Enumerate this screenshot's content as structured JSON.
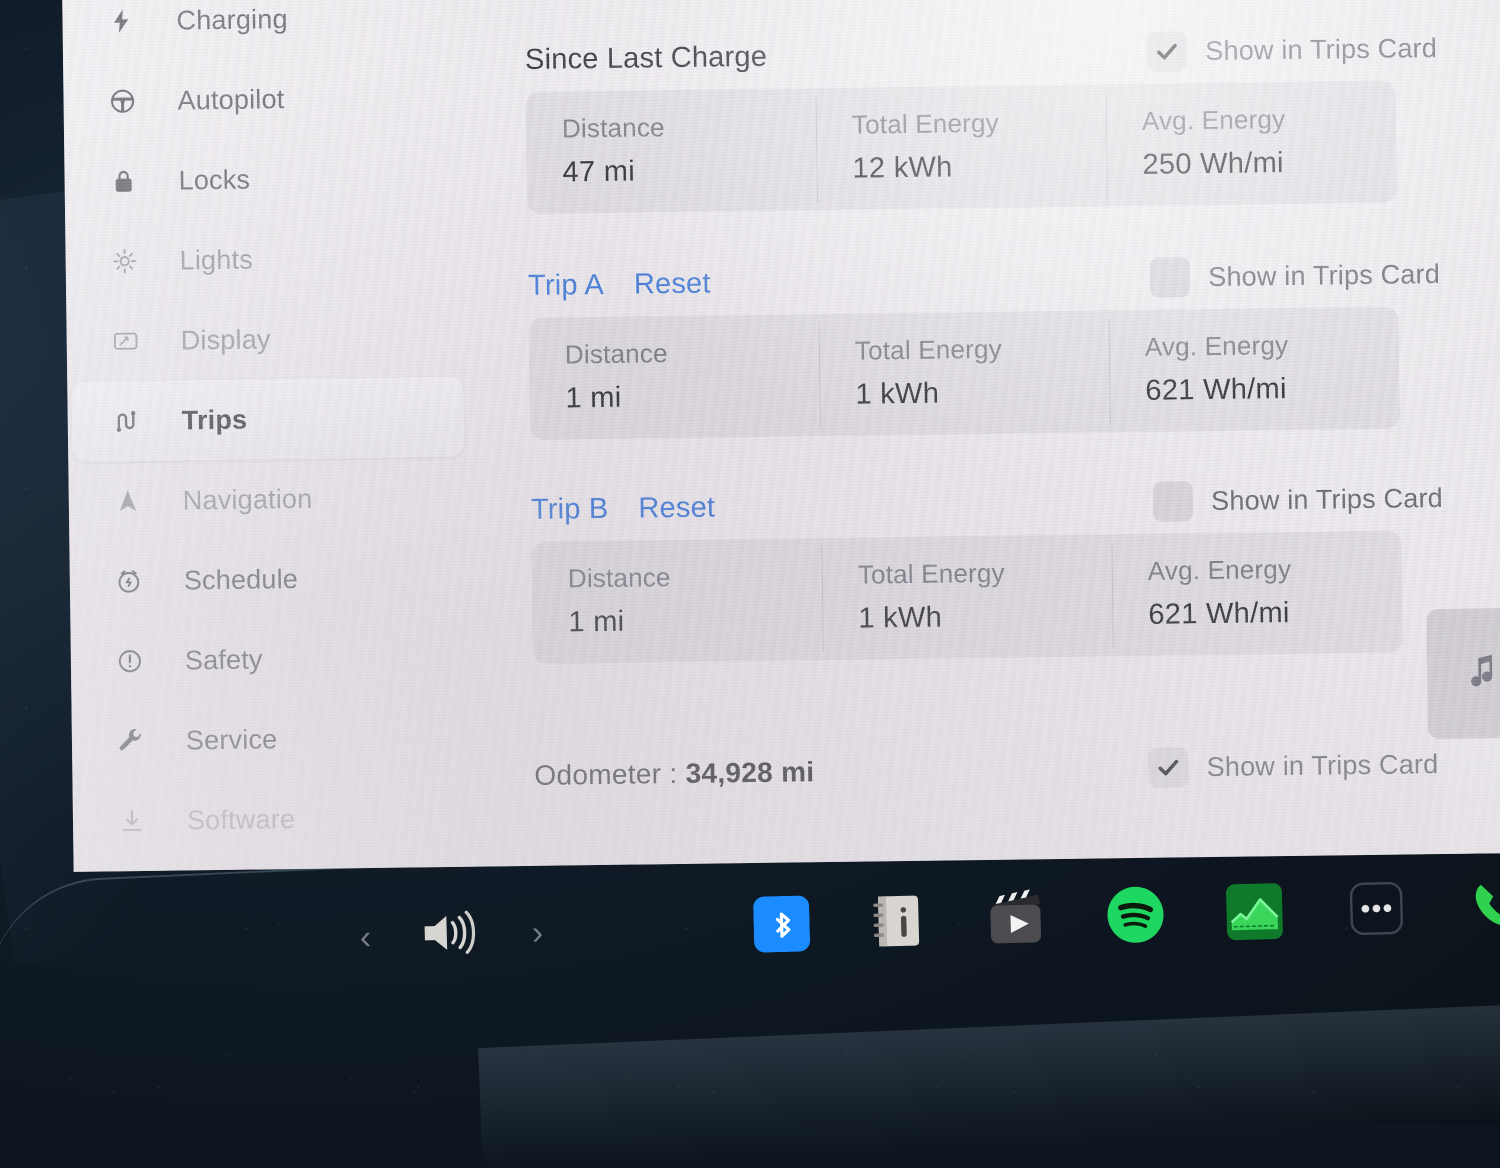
{
  "sidebar": {
    "items": [
      {
        "label": "Charging",
        "icon": "bolt-icon",
        "state": "normal"
      },
      {
        "label": "Autopilot",
        "icon": "steering-wheel-icon",
        "state": "normal"
      },
      {
        "label": "Locks",
        "icon": "lock-icon",
        "state": "normal"
      },
      {
        "label": "Lights",
        "icon": "lights-icon",
        "state": "faded"
      },
      {
        "label": "Display",
        "icon": "display-icon",
        "state": "faded"
      },
      {
        "label": "Trips",
        "icon": "trips-route-icon",
        "state": "active"
      },
      {
        "label": "Navigation",
        "icon": "navigation-arrow-icon",
        "state": "faded"
      },
      {
        "label": "Schedule",
        "icon": "schedule-clock-icon",
        "state": "normal"
      },
      {
        "label": "Safety",
        "icon": "safety-alert-icon",
        "state": "normal"
      },
      {
        "label": "Service",
        "icon": "wrench-icon",
        "state": "normal"
      },
      {
        "label": "Software",
        "icon": "download-icon",
        "state": "ghost"
      }
    ]
  },
  "content": {
    "show_in_trips_card_label": "Show in Trips Card",
    "columns": {
      "distance": "Distance",
      "total_energy": "Total Energy",
      "avg_energy": "Avg. Energy"
    },
    "sections": [
      {
        "id": "since-last-charge",
        "title": "Since Last Charge",
        "is_trip": false,
        "reset_label": "",
        "show_in_trips_card": true,
        "distance": "47 mi",
        "total_energy": "12 kWh",
        "avg_energy": "250 Wh/mi"
      },
      {
        "id": "trip-a",
        "title": "Trip A",
        "is_trip": true,
        "reset_label": "Reset",
        "show_in_trips_card": false,
        "distance": "1 mi",
        "total_energy": "1 kWh",
        "avg_energy": "621 Wh/mi"
      },
      {
        "id": "trip-b",
        "title": "Trip B",
        "is_trip": true,
        "reset_label": "Reset",
        "show_in_trips_card": false,
        "distance": "1 mi",
        "total_energy": "1 kWh",
        "avg_energy": "621 Wh/mi"
      }
    ],
    "odometer": {
      "label": "Odometer",
      "separator": ":",
      "value": "34,928 mi",
      "show_in_trips_card": true
    },
    "media_card": {
      "icon": "music-note-icon"
    }
  },
  "taskbar": {
    "items": [
      {
        "name": "previous-track-button",
        "icon": "chevron-left-icon",
        "label": ""
      },
      {
        "name": "volume-button",
        "icon": "volume-icon",
        "label": ""
      },
      {
        "name": "next-track-button",
        "icon": "chevron-right-icon",
        "label": ""
      },
      {
        "name": "bluetooth-app",
        "icon": "bluetooth-icon",
        "label": ""
      },
      {
        "name": "manual-app",
        "icon": "owners-manual-icon",
        "label": ""
      },
      {
        "name": "theater-app",
        "icon": "theater-clapper-icon",
        "label": ""
      },
      {
        "name": "spotify-app",
        "icon": "spotify-icon",
        "label": ""
      },
      {
        "name": "energy-app",
        "icon": "energy-chart-icon",
        "label": ""
      },
      {
        "name": "more-apps-button",
        "icon": "ellipsis-icon",
        "label": ""
      },
      {
        "name": "phone-app",
        "icon": "phone-icon",
        "label": ""
      }
    ]
  },
  "colors": {
    "link_blue": "#2f6fd8",
    "bluetooth_blue": "#1a8cff",
    "spotify_green": "#1ed760",
    "energy_green": "#1aa63c",
    "phone_green": "#2fd14f",
    "screen_bg": "#edeaee",
    "bezel": "#0d1620"
  }
}
